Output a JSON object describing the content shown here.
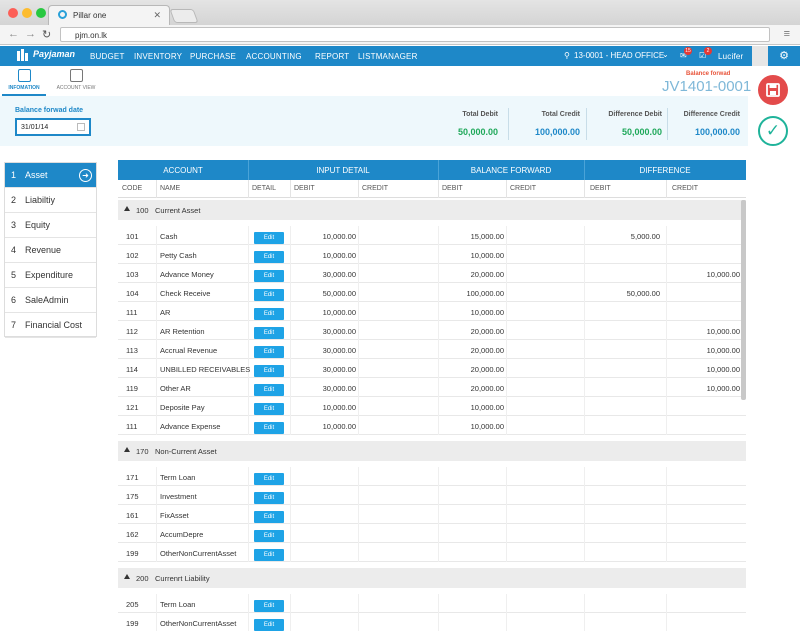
{
  "browser": {
    "tab_title": "Pillar one",
    "url": "pjm.on.lk"
  },
  "nav": {
    "logo": "Payjaman",
    "items": [
      "BUDGET",
      "INVENTORY",
      "PURCHASE",
      "ACCOUNTING",
      "REPORT",
      "LISTMANAGER"
    ],
    "office": "13-0001 - HEAD OFFICE",
    "notif_count_1": "15",
    "notif_count_2": "2",
    "user": "Lucifer"
  },
  "subtabs": {
    "information": "INFOMATION",
    "account_view": "ACCOUNT VIEW"
  },
  "voucher": {
    "label": "Balance forwad",
    "number": "JV1401-0001"
  },
  "header": {
    "date_label": "Balance forwad date",
    "date_value": "31/01/14",
    "total_debit_label": "Total Debit",
    "total_debit": "50,000.00",
    "total_credit_label": "Total Credit",
    "total_credit": "100,000.00",
    "diff_debit_label": "Difference Debit",
    "diff_debit": "50,000.00",
    "diff_credit_label": "Difference Credit",
    "diff_credit": "100,000.00"
  },
  "colors": {
    "primary": "#1e88c8",
    "green": "#1fa85a",
    "save": "#e34b4b",
    "confirm": "#1fb39a"
  },
  "sidebar": {
    "items": [
      {
        "num": "1",
        "label": "Asset"
      },
      {
        "num": "2",
        "label": "Liabiltiy"
      },
      {
        "num": "3",
        "label": "Equity"
      },
      {
        "num": "4",
        "label": "Revenue"
      },
      {
        "num": "5",
        "label": "Expenditure"
      },
      {
        "num": "6",
        "label": "SaleAdmin"
      },
      {
        "num": "7",
        "label": "Financial Cost"
      }
    ]
  },
  "table": {
    "groups": [
      "ACCOUNT",
      "INPUT DETAIL",
      "BALANCE FORWARD",
      "DIFFERENCE"
    ],
    "columns": [
      "CODE",
      "NAME",
      "DETAIL",
      "DEBIT",
      "CREDIT",
      "DEBIT",
      "CREDIT",
      "DEBIT",
      "CREDIT"
    ],
    "edit_label": "Edit",
    "sections": [
      {
        "code": "100",
        "name": "Current Asset",
        "rows": [
          {
            "code": "101",
            "name": "Cash",
            "in_debit": "10,000.00",
            "in_credit": "",
            "bf_debit": "15,000.00",
            "bf_credit": "",
            "df_debit": "5,000.00",
            "df_credit": ""
          },
          {
            "code": "102",
            "name": "Petty Cash",
            "in_debit": "10,000.00",
            "in_credit": "",
            "bf_debit": "10,000.00",
            "bf_credit": "",
            "df_debit": "",
            "df_credit": ""
          },
          {
            "code": "103",
            "name": "Advance Money",
            "in_debit": "30,000.00",
            "in_credit": "",
            "bf_debit": "20,000.00",
            "bf_credit": "",
            "df_debit": "",
            "df_credit": "10,000.00"
          },
          {
            "code": "104",
            "name": "Check Receive",
            "in_debit": "50,000.00",
            "in_credit": "",
            "bf_debit": "100,000.00",
            "bf_credit": "",
            "df_debit": "50,000.00",
            "df_credit": ""
          },
          {
            "code": "111",
            "name": "AR",
            "in_debit": "10,000.00",
            "in_credit": "",
            "bf_debit": "10,000.00",
            "bf_credit": "",
            "df_debit": "",
            "df_credit": ""
          },
          {
            "code": "112",
            "name": "AR Retention",
            "in_debit": "30,000.00",
            "in_credit": "",
            "bf_debit": "20,000.00",
            "bf_credit": "",
            "df_debit": "",
            "df_credit": "10,000.00"
          },
          {
            "code": "113",
            "name": "Accrual Revenue",
            "in_debit": "30,000.00",
            "in_credit": "",
            "bf_debit": "20,000.00",
            "bf_credit": "",
            "df_debit": "",
            "df_credit": "10,000.00"
          },
          {
            "code": "114",
            "name": "UNBILLED RECEIVABLES",
            "in_debit": "30,000.00",
            "in_credit": "",
            "bf_debit": "20,000.00",
            "bf_credit": "",
            "df_debit": "",
            "df_credit": "10,000.00"
          },
          {
            "code": "119",
            "name": "Other AR",
            "in_debit": "30,000.00",
            "in_credit": "",
            "bf_debit": "20,000.00",
            "bf_credit": "",
            "df_debit": "",
            "df_credit": "10,000.00"
          },
          {
            "code": "121",
            "name": "Deposite Pay",
            "in_debit": "10,000.00",
            "in_credit": "",
            "bf_debit": "10,000.00",
            "bf_credit": "",
            "df_debit": "",
            "df_credit": ""
          },
          {
            "code": "111",
            "name": "Advance Expense",
            "in_debit": "10,000.00",
            "in_credit": "",
            "bf_debit": "10,000.00",
            "bf_credit": "",
            "df_debit": "",
            "df_credit": ""
          }
        ]
      },
      {
        "code": "170",
        "name": "Non-Current Asset",
        "rows": [
          {
            "code": "171",
            "name": "Term Loan"
          },
          {
            "code": "175",
            "name": "Investment"
          },
          {
            "code": "161",
            "name": "FixAsset"
          },
          {
            "code": "162",
            "name": "AccumDepre"
          },
          {
            "code": "199",
            "name": "OtherNonCurrentAsset"
          }
        ]
      },
      {
        "code": "200",
        "name": "Currenrt Liability",
        "rows": [
          {
            "code": "205",
            "name": "Term Loan"
          },
          {
            "code": "199",
            "name": "OtherNonCurrentAsset"
          }
        ]
      }
    ]
  }
}
